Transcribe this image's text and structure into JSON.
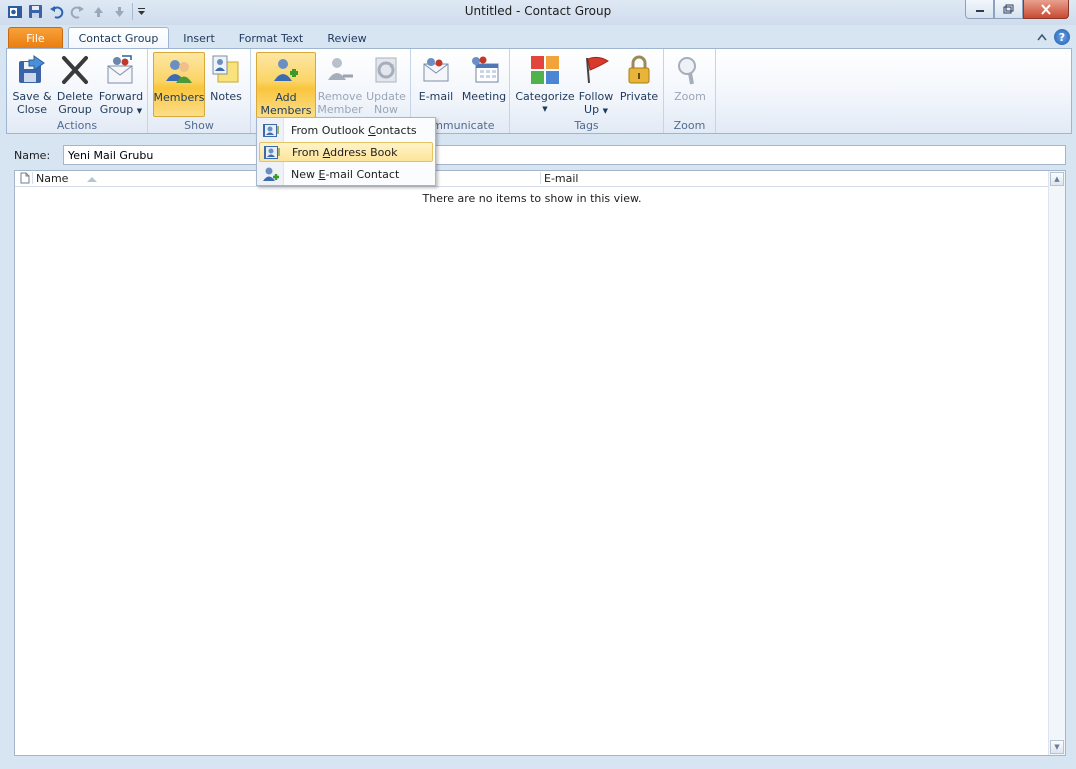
{
  "window": {
    "title": "Untitled  -  Contact Group"
  },
  "quick_access": {
    "icons": [
      "outlook-app-icon",
      "save-icon",
      "undo-icon",
      "redo-icon",
      "previous-item-icon",
      "next-item-icon",
      "customize-qat-icon"
    ]
  },
  "tabs": {
    "file": "File",
    "items": [
      "Contact Group",
      "Insert",
      "Format Text",
      "Review"
    ],
    "active": "Contact Group"
  },
  "ribbon": {
    "groups": {
      "actions": "Actions",
      "show": "Show",
      "communicate": "ommunicate",
      "tags": "Tags",
      "zoom": "Zoom"
    },
    "buttons": {
      "save_close": [
        "Save &",
        "Close"
      ],
      "delete_group": [
        "Delete",
        "Group"
      ],
      "forward_group": [
        "Forward",
        "Group"
      ],
      "members": "Members",
      "notes": "Notes",
      "add_members": [
        "Add",
        "Members"
      ],
      "remove_member": [
        "Remove",
        "Member"
      ],
      "update_now": [
        "Update",
        "Now"
      ],
      "email": "E-mail",
      "meeting": "Meeting",
      "categorize": "Categorize",
      "follow_up": [
        "Follow",
        "Up"
      ],
      "private": "Private",
      "zoom": "Zoom"
    }
  },
  "add_members_menu": {
    "items": [
      {
        "pre": "From Outlook ",
        "key": "C",
        "post": "ontacts"
      },
      {
        "pre": "From ",
        "key": "A",
        "post": "ddress Book"
      },
      {
        "pre": "New ",
        "key": "E",
        "post": "-mail Contact"
      }
    ],
    "highlighted": "From Address Book"
  },
  "name_field": {
    "label": "Name:",
    "value": "Yeni Mail Grubu"
  },
  "member_list": {
    "columns": [
      "Name",
      "E-mail"
    ],
    "empty_message": "There are no items to show in this view."
  },
  "colors": {
    "file_tab": "#e97b0e",
    "selected_button": "#fbd465",
    "ribbon_border": "#9fb6d3"
  }
}
